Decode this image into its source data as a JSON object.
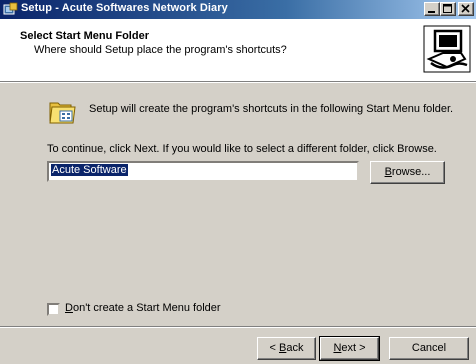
{
  "window": {
    "title": "Setup - Acute Softwares Network Diary"
  },
  "header": {
    "title": "Select Start Menu Folder",
    "subtitle": "Where should Setup place the program's shortcuts?"
  },
  "body": {
    "intro": "Setup will create the program's shortcuts in the following Start Menu folder.",
    "instruction": "To continue, click Next. If you would like to select a different folder, click Browse.",
    "folder_value": "Acute Software",
    "browse_prefix": "",
    "browse_access": "B",
    "browse_rest": "rowse...",
    "checkbox_access": "D",
    "checkbox_rest": "on't create a Start Menu folder",
    "checkbox_checked": false
  },
  "footer": {
    "back_prefix": "< ",
    "back_access": "B",
    "back_rest": "ack",
    "next_access": "N",
    "next_rest": "ext >",
    "cancel_label": "Cancel"
  },
  "icons": {
    "app": "setup-app-icon",
    "header": "computer-wizard-icon",
    "folder": "start-menu-folder-icon",
    "minimize": "minimize-icon",
    "maximize": "maximize-icon",
    "close": "close-icon"
  }
}
